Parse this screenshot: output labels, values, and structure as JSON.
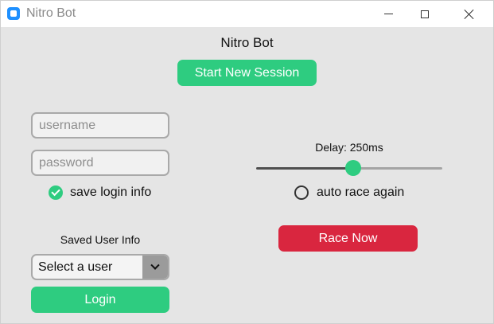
{
  "window": {
    "title": "Nitro Bot"
  },
  "header": {
    "title": "Nitro Bot",
    "start_label": "Start New Session"
  },
  "login": {
    "username_placeholder": "username",
    "username_value": "",
    "password_placeholder": "password",
    "password_value": "",
    "save_login_label": "save login info",
    "save_login_checked": true,
    "saved_user_label": "Saved User Info",
    "select_value": "Select a user",
    "login_label": "Login"
  },
  "race": {
    "delay_label": "Delay: 250ms",
    "delay_fraction": 0.5,
    "auto_race_label": "auto race again",
    "auto_race_checked": false,
    "race_label": "Race Now"
  },
  "colors": {
    "accent_green": "#2ecc80",
    "race_red": "#d9263f"
  },
  "icons": {
    "app": "app-icon",
    "minimize": "minimize-icon",
    "maximize": "maximize-icon",
    "close": "close-icon",
    "check": "check-icon",
    "dropdown": "chevron-down-icon"
  }
}
